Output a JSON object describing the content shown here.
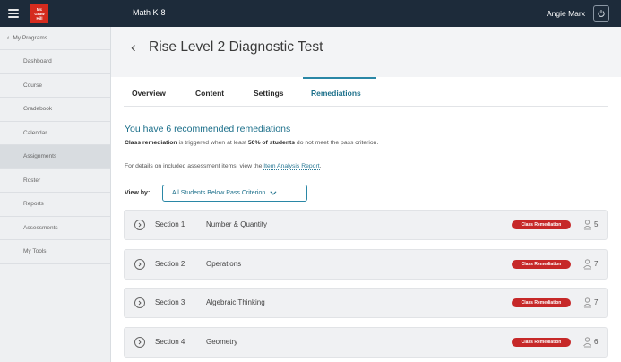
{
  "topbar": {
    "logo_lines": [
      "Mc",
      "Graw",
      "Hill"
    ],
    "app_title": "Math K-8",
    "user_name": "Angie Marx"
  },
  "sidebar": {
    "back_label": "My Programs",
    "items": [
      {
        "label": "Dashboard",
        "active": false
      },
      {
        "label": "Course",
        "active": false
      },
      {
        "label": "Gradebook",
        "active": false
      },
      {
        "label": "Calendar",
        "active": false
      },
      {
        "label": "Assignments",
        "active": true
      },
      {
        "label": "Roster",
        "active": false
      },
      {
        "label": "Reports",
        "active": false
      },
      {
        "label": "Assessments",
        "active": false
      },
      {
        "label": "My Tools",
        "active": false
      }
    ]
  },
  "page": {
    "title": "Rise Level 2 Diagnostic Test",
    "tabs": [
      "Overview",
      "Content",
      "Settings",
      "Remediations"
    ],
    "active_tab": "Remediations"
  },
  "remediations": {
    "heading": "You have 6 recommended remediations",
    "desc_bold1": "Class remediation",
    "desc_text1": " is triggered when at least ",
    "desc_bold2": "50% of students",
    "desc_text2": " do not meet the pass criterion.",
    "details_text": "For details on included assessment items, view the ",
    "details_link": "Item Analysis Report",
    "details_end": ".",
    "viewby_label": "View by:",
    "viewby_value": "All Students Below Pass Criterion",
    "sections": [
      {
        "number": "Section 1",
        "name": "Number & Quantity",
        "badge": "Class Remediation",
        "count": "5"
      },
      {
        "number": "Section 2",
        "name": "Operations",
        "badge": "Class Remediation",
        "count": "7"
      },
      {
        "number": "Section 3",
        "name": "Algebraic Thinking",
        "badge": "Class Remediation",
        "count": "7"
      },
      {
        "number": "Section 4",
        "name": "Geometry",
        "badge": "Class Remediation",
        "count": "6"
      }
    ]
  },
  "colors": {
    "topbar": "#1d2b3a",
    "accent": "#1b6f8a",
    "badge": "#c62828",
    "logo": "#d52b1e"
  }
}
